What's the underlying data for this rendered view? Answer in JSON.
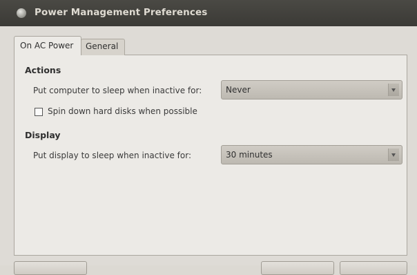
{
  "window": {
    "title": "Power Management Preferences"
  },
  "tabs": [
    {
      "label": "On AC Power",
      "active": true
    },
    {
      "label": "General",
      "active": false
    }
  ],
  "actions": {
    "heading": "Actions",
    "sleep_label": "Put computer to sleep when inactive for:",
    "sleep_value": "Never",
    "spin_down_label": "Spin down hard disks when possible",
    "spin_down_checked": false
  },
  "display": {
    "heading": "Display",
    "sleep_label": "Put display to sleep when inactive for:",
    "sleep_value": "30 minutes"
  },
  "colors": {
    "titlebar": "#3f3e3a",
    "window_bg": "#dedbd6",
    "panel_bg": "#eceae6",
    "combo_bg": "#c7c3bc"
  },
  "icons": {
    "window_icon": "power-icon",
    "combo_arrow": "dropdown-arrow-icon"
  }
}
